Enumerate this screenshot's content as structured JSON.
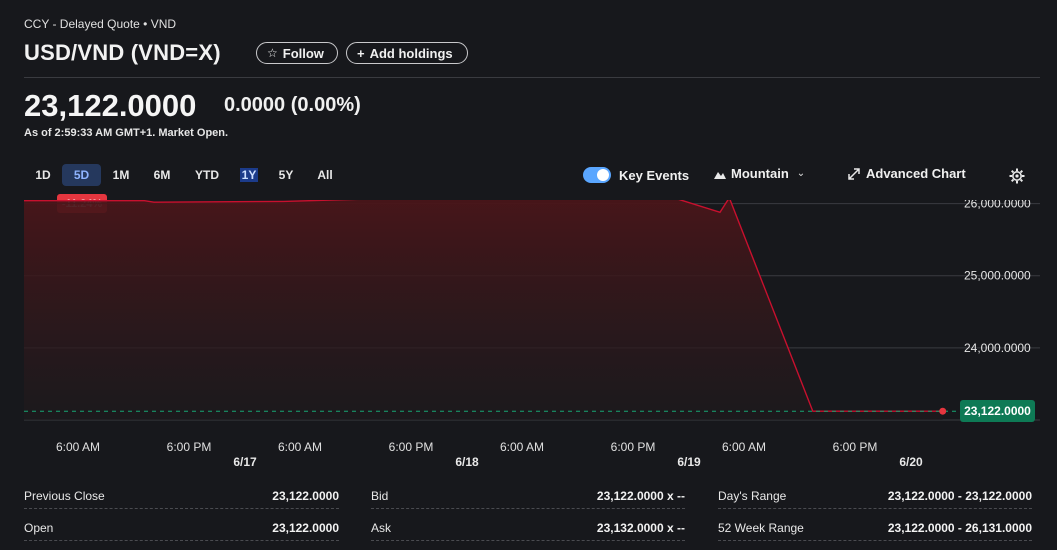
{
  "header": {
    "breadcrumb": "CCY - Delayed Quote • VND",
    "title": "USD/VND (VND=X)",
    "follow_label": "Follow",
    "add_holdings_label": "Add holdings"
  },
  "quote": {
    "price": "23,122.0000",
    "change": "0.0000 (0.00%)",
    "as_of": "As of 2:59:33 AM GMT+1. Market Open."
  },
  "ranges": [
    "1D",
    "5D",
    "1M",
    "6M",
    "YTD",
    "1Y",
    "5Y",
    "All"
  ],
  "controls": {
    "key_events_label": "Key Events",
    "chart_type_label": "Mountain",
    "advanced_chart_label": "Advanced Chart"
  },
  "chart_data": {
    "type": "area",
    "period_change": "-11.24%",
    "x_tick_labels": [
      "6:00 AM",
      "6:00 PM",
      "6:00 AM",
      "6:00 PM",
      "6:00 AM",
      "6:00 PM",
      "6:00 AM",
      "6:00 PM"
    ],
    "date_labels": [
      "6/17",
      "6/18",
      "6/19",
      "6/20"
    ],
    "y_tick_labels": [
      "26,000.0000",
      "25,000.0000",
      "24,000.0000"
    ],
    "y_ticks": [
      26000,
      25000,
      24000
    ],
    "ylim": [
      23000,
      26050
    ],
    "last_value_label": "23,122.0000",
    "last_value": 23122,
    "series": [
      {
        "x": [
          0,
          0.13,
          0.14,
          0.28,
          0.36,
          0.55,
          0.7,
          0.75,
          0.76,
          0.85,
          0.99
        ],
        "values": [
          26040,
          26040,
          26020,
          26030,
          26060,
          26080,
          26080,
          25880,
          26080,
          23122,
          23122
        ]
      }
    ],
    "line_color": "#c8102e",
    "fill_color": "#3a1316",
    "grid": true
  },
  "stats": {
    "col1": [
      {
        "label": "Previous Close",
        "value": "23,122.0000"
      },
      {
        "label": "Open",
        "value": "23,122.0000"
      }
    ],
    "col2": [
      {
        "label": "Bid",
        "value": "23,122.0000 x --"
      },
      {
        "label": "Ask",
        "value": "23,132.0000 x --"
      }
    ],
    "col3": [
      {
        "label": "Day's Range",
        "value": "23,122.0000 - 23,122.0000"
      },
      {
        "label": "52 Week Range",
        "value": "23,122.0000 - 26,131.0000"
      }
    ]
  }
}
